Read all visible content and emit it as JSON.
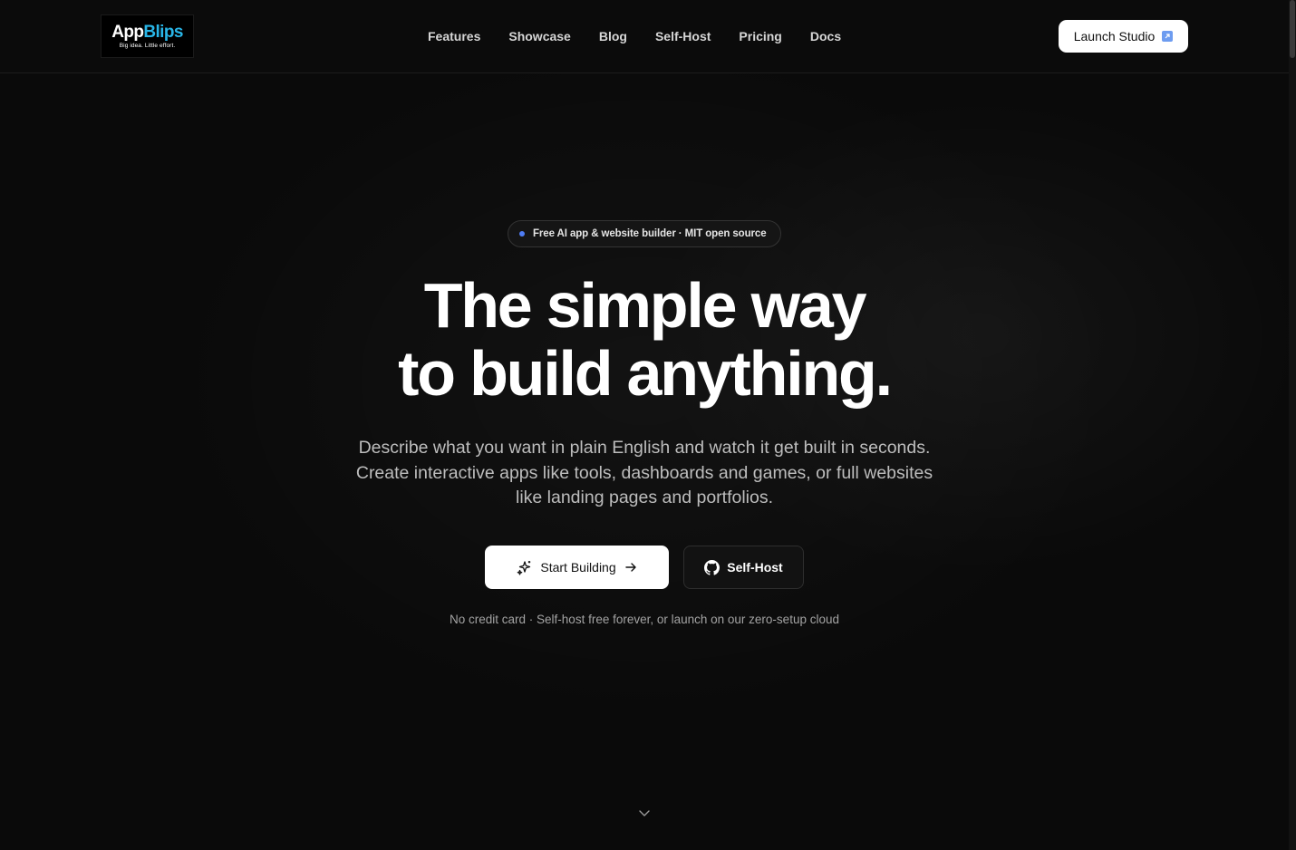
{
  "header": {
    "logo": {
      "word_app": "App",
      "word_blips": "Blips",
      "tagline": "Big idea. Little effort."
    },
    "nav": [
      "Features",
      "Showcase",
      "Blog",
      "Self-Host",
      "Pricing",
      "Docs"
    ],
    "launch_label": "Launch Studio"
  },
  "hero": {
    "badge": "Free AI app & website builder · MIT open source",
    "headline_line1": "The simple way",
    "headline_line2": "to build anything.",
    "subtitle_line1": "Describe what you want in plain English and watch it get built in seconds.",
    "subtitle_line2": "Create interactive apps like tools, dashboards and games, or full websites",
    "subtitle_line3": "like landing pages and portfolios.",
    "primary_cta": "Start Building",
    "secondary_cta": "Self-Host",
    "note": "No credit card · Self-host free forever, or launch on our zero-setup cloud"
  },
  "icons": {
    "launch": "external-link-icon",
    "primary": "sparkles-icon",
    "primary_trailing": "arrow-right-icon",
    "secondary": "github-icon",
    "scroll": "chevron-down-icon"
  },
  "colors": {
    "background": "#0a0a0a",
    "brand_accent": "#29b6e8",
    "badge_dot": "#4f7df5",
    "button_light": "#ffffff"
  }
}
